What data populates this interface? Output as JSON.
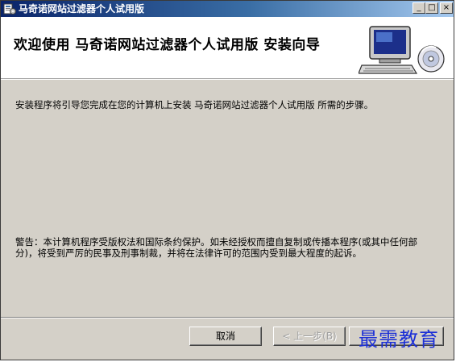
{
  "window": {
    "title": "马奇诺网站过滤器个人试用版",
    "controls": {
      "minimize": "_",
      "maximize": "□",
      "close": "×"
    }
  },
  "header": {
    "title": "欢迎使用  马奇诺网站过滤器个人试用版  安装向导",
    "graphic": "computer-cd-icon"
  },
  "body": {
    "intro": "安装程序将引导您完成在您的计算机上安装  马奇诺网站过滤器个人试用版  所需的步骤。",
    "warning": "警告：本计算机程序受版权法和国际条约保护。如未经授权而擅自复制或传播本程序(或其中任何部分)，将受到严厉的民事及刑事制裁，并将在法律许可的范围内受到最大程度的起诉。"
  },
  "buttons": {
    "cancel": "取消",
    "back": "< 上一步(B)"
  },
  "watermark": "最需教育",
  "colors": {
    "titlebar_start": "#0a246a",
    "titlebar_end": "#a6caf0",
    "dialog_face": "#d4d0c8",
    "watermark": "#1b2fd6"
  }
}
